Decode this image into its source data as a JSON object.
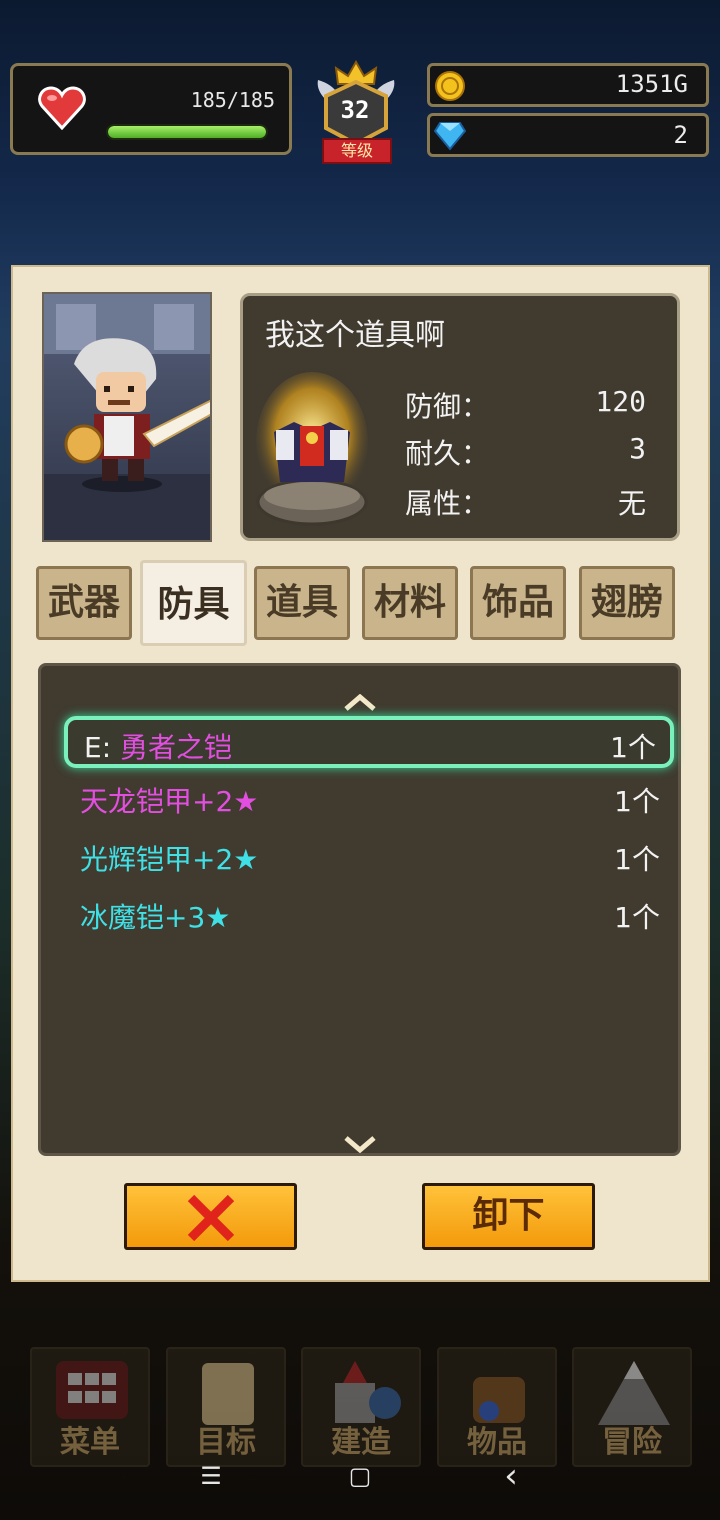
{
  "hud": {
    "hp_text": "185/185",
    "hp_fraction": 1.0,
    "level": "32",
    "level_label": "等级",
    "gold": "1351G",
    "gems": "2"
  },
  "item": {
    "title": "我这个道具啊",
    "stats": [
      {
        "label": "防御：",
        "value": "120"
      },
      {
        "label": "耐久：",
        "value": "3"
      },
      {
        "label": "属性：",
        "value": "无"
      }
    ]
  },
  "tabs": [
    {
      "label": "武器",
      "active": false
    },
    {
      "label": "防具",
      "active": true
    },
    {
      "label": "道具",
      "active": false
    },
    {
      "label": "材料",
      "active": false
    },
    {
      "label": "饰品",
      "active": false
    },
    {
      "label": "翅膀",
      "active": false
    }
  ],
  "list": {
    "scroll_up": "^",
    "scroll_down": "v",
    "rows": [
      {
        "prefix": "E:",
        "name": "勇者之铠",
        "qty": "1个",
        "color": "#e24fe0",
        "selected": true
      },
      {
        "prefix": "",
        "name": "天龙铠甲+2★",
        "qty": "1个",
        "color": "#e24fe0",
        "selected": false
      },
      {
        "prefix": "",
        "name": "光辉铠甲+2★",
        "qty": "1个",
        "color": "#3fe0e6",
        "selected": false
      },
      {
        "prefix": "",
        "name": "冰魔铠+3★",
        "qty": "1个",
        "color": "#3fe0e6",
        "selected": false
      }
    ]
  },
  "buttons": {
    "close_icon": "close-x-icon",
    "unequip_label": "卸下"
  },
  "bottom_nav": [
    {
      "label": "菜单",
      "icon": "grid-menu-icon"
    },
    {
      "label": "目标",
      "icon": "quest-scroll-icon"
    },
    {
      "label": "建造",
      "icon": "castle-icon"
    },
    {
      "label": "物品",
      "icon": "bag-icon"
    },
    {
      "label": "冒险",
      "icon": "mountain-icon"
    }
  ],
  "system_nav": {
    "menu": "☰",
    "home": "▢",
    "back": "‹"
  },
  "colors": {
    "panel_bg": "#efe5cc",
    "dark_box": "#403a2f",
    "button_orange": "#f5a512",
    "selection_glow": "#7af0bc"
  }
}
